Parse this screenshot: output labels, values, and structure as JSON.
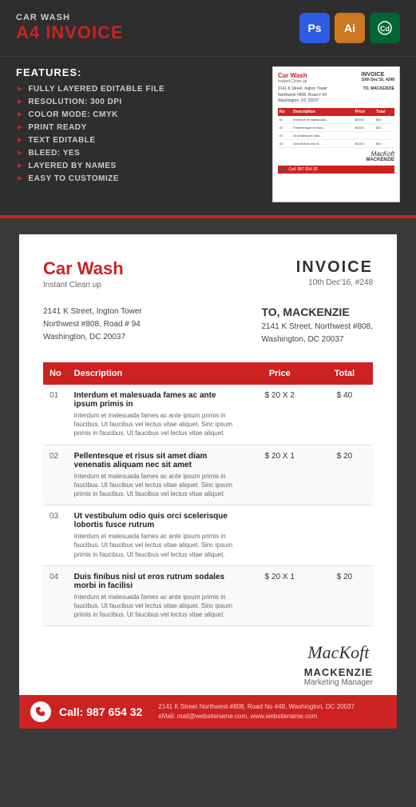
{
  "header": {
    "product_type": "CAR WASH",
    "product_title": "A4 INVOICE",
    "badges": [
      {
        "label": "Ps",
        "type": "ps"
      },
      {
        "label": "Ai",
        "type": "ai"
      },
      {
        "label": "Cd",
        "type": "cd"
      }
    ]
  },
  "features": {
    "title": "FEATURES:",
    "items": [
      "FULLY LAYERED EDITABLE FILE",
      "RESOLUTION: 300 DPI",
      "COLOR MODE: CMYK",
      "PRINT READY",
      "TEXT EDITABLE",
      "BLEED: YES",
      "LAYERED BY NAMES",
      "EASY TO CUSTOMIZE"
    ]
  },
  "invoice": {
    "company_name": "Car Wash",
    "company_sub": "Instant Clean up",
    "title": "INVOICE",
    "date": "10th Dec'16, #248",
    "from_address": "2141 K Street, Ington Tower\nNorthwest #808, Road # 94\nWashington, DC 20037",
    "to_label": "TO, MACKENZIE",
    "to_address": "2141 K Street, Northwest #808,\nWashington, DC 20037",
    "table": {
      "headers": [
        "No",
        "Description",
        "Price",
        "Total"
      ],
      "rows": [
        {
          "no": "01",
          "desc_main": "Interdum et malesuada fames ac ante ipsum primis in",
          "desc_sub": "Interdum et malesuada fames ac ante ipsum primis in faucibus. Ut faucibus vel lectus vitae aliquet.\nSinc ipsum primis in faucibus. Ut faucibus vel lectus vitae aliquet.",
          "price": "$ 20 X 2",
          "total": "$ 40"
        },
        {
          "no": "02",
          "desc_main": "Pellentesque et risus sit amet diam venenatis aliquam nec sit amet",
          "desc_sub": "Interdum et malesuada fames ac ante ipsum primis in faucibus. Ut faucibus vel lectus vitae aliquet.\nSinc ipsum primis in faucibus. Ut faucibus vel lectus vitae aliquet.",
          "price": "$ 20 X 1",
          "total": "$ 20"
        },
        {
          "no": "03",
          "desc_main": "Ut vestibulum odio quis orci scelerisque lobortis fusce rutrum",
          "desc_sub": "Interdum et malesuada fames ac ante ipsum primis in faucibus. Ut faucibus vel lectus vitae aliquet.\nSinc ipsum primis in faucibus. Ut faucibus vel lectus vitae aliquet.",
          "price": "",
          "total": ""
        },
        {
          "no": "04",
          "desc_main": "Duis finibus nisl ut eros rutrum sodales morbi in facilisi",
          "desc_sub": "Interdum et malesuada fames ac ante ipsum primis in faucibus. Ut faucibus vel lectus vitae aliquet.\nSinc ipsum primis in faucibus. Ut faucibus vel lectus vitae aliquet.",
          "price": "$ 20 X 1",
          "total": "$ 20"
        }
      ]
    },
    "signature": {
      "script": "MacKoft",
      "name": "MACKENZIE",
      "title": "Marketing Manager"
    },
    "footer": {
      "call_label": "Call: 987 654 32",
      "address": "2141 K Street Northwest #808, Road No #48, Washington, DC 20037",
      "email": "eMail: mail@websitename.com, www.websitename.com"
    }
  },
  "preview": {
    "car_wash_label": "Car Wash",
    "invoice_label": "INVOICE",
    "to_mackenzie": "TO, MACKENZIE",
    "call_preview": "Call: 987 654 32"
  }
}
